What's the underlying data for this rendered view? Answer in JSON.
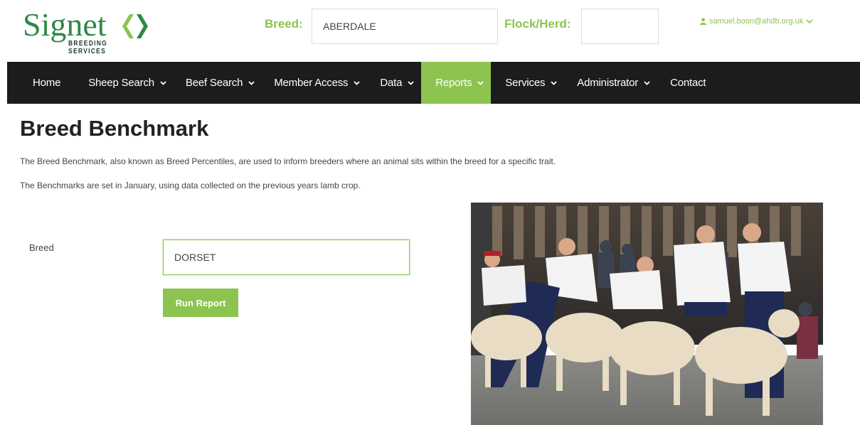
{
  "brand": {
    "name": "Signet",
    "tagline": "BREEDING SERVICES",
    "primary_color": "#2e8a47",
    "accent_color": "#8dc44f"
  },
  "header": {
    "breed_label": "Breed:",
    "breed_value": "ABERDALE",
    "flock_label": "Flock/Herd:",
    "flock_value": "",
    "user_email": "samuel.boon@ahdb.org.uk"
  },
  "nav": {
    "items": [
      {
        "label": "Home",
        "dropdown": false
      },
      {
        "label": "Sheep Search",
        "dropdown": true
      },
      {
        "label": "Beef Search",
        "dropdown": true
      },
      {
        "label": "Member Access",
        "dropdown": true
      },
      {
        "label": "Data",
        "dropdown": true
      },
      {
        "label": "Reports",
        "dropdown": true,
        "active": true
      },
      {
        "label": "Services",
        "dropdown": true
      },
      {
        "label": "Administrator",
        "dropdown": true
      },
      {
        "label": "Contact",
        "dropdown": false
      }
    ]
  },
  "page": {
    "title": "Breed Benchmark",
    "description_1": "The Breed Benchmark, also known as Breed Percentiles, are used to inform breeders where an animal sits within the breed for a specific trait.",
    "description_2": "The Benchmarks are set in January, using data collected on the previous years lamb crop."
  },
  "form": {
    "breed_label": "Breed",
    "breed_value": "DORSET",
    "run_button": "Run Report"
  }
}
